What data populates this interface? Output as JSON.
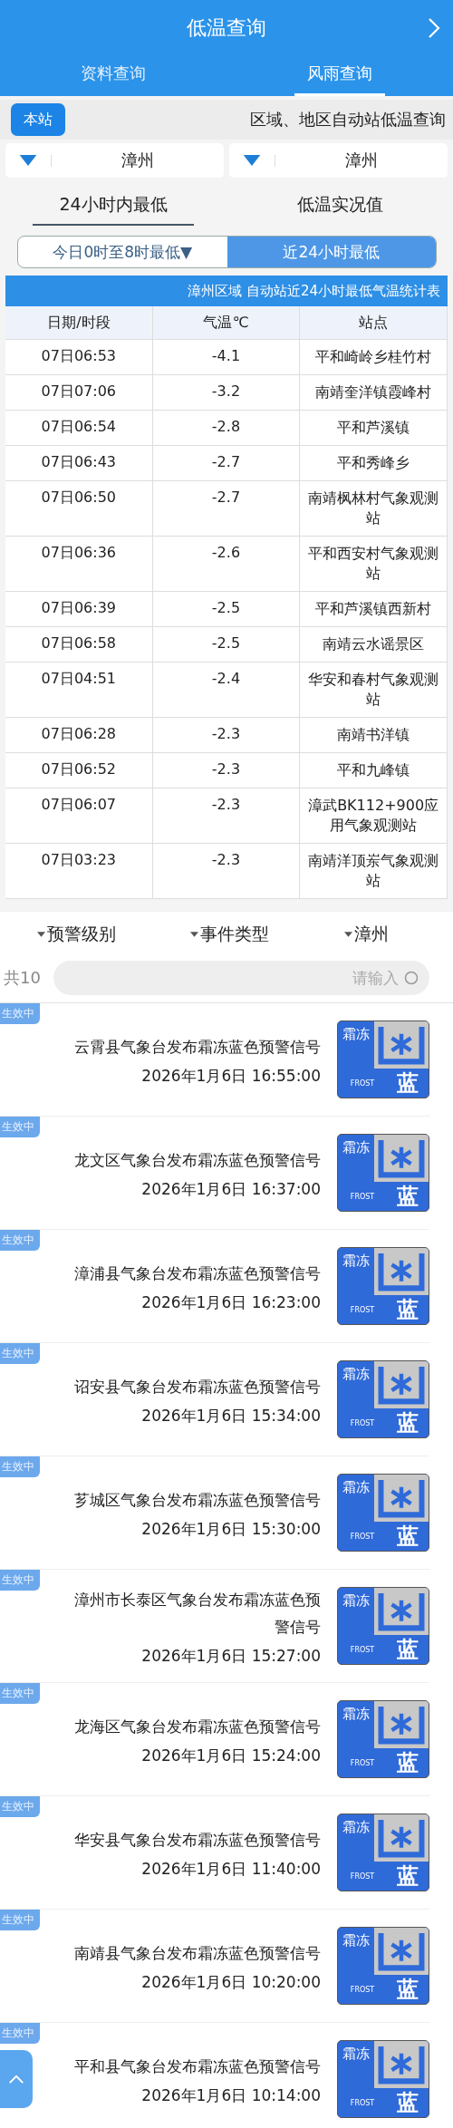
{
  "header": {
    "title": "低温查询"
  },
  "tabs": [
    {
      "label": "资料查询",
      "selected": false
    },
    {
      "label": "风雨查询",
      "selected": true
    }
  ],
  "notice": {
    "button": "本站",
    "text": "区域、地区自动站低温查询"
  },
  "selects": [
    {
      "value": "漳州"
    },
    {
      "value": "漳州"
    }
  ],
  "sub_tabs": [
    {
      "label": "24小时内最低",
      "selected": true
    },
    {
      "label": "低温实况值",
      "selected": false
    }
  ],
  "segments": [
    {
      "label": "今日0时至8时最低▼",
      "selected": false
    },
    {
      "label": "近24小时最低",
      "selected": true
    }
  ],
  "table": {
    "title": "漳州区域 自动站近24小时最低气温统计表",
    "columns": [
      "日期/时段",
      "气温℃",
      "站点"
    ],
    "rows": [
      [
        "07日06:53",
        "-4.1",
        "平和崎岭乡桂竹村"
      ],
      [
        "07日07:06",
        "-3.2",
        "南靖奎洋镇霞峰村"
      ],
      [
        "07日06:54",
        "-2.8",
        "平和芦溪镇"
      ],
      [
        "07日06:43",
        "-2.7",
        "平和秀峰乡"
      ],
      [
        "07日06:50",
        "-2.7",
        "南靖枫林村气象观测站"
      ],
      [
        "07日06:36",
        "-2.6",
        "平和西安村气象观测站"
      ],
      [
        "07日06:39",
        "-2.5",
        "平和芦溪镇西新村"
      ],
      [
        "07日06:58",
        "-2.5",
        "南靖云水谣景区"
      ],
      [
        "07日04:51",
        "-2.4",
        "华安和春村气象观测站"
      ],
      [
        "07日06:28",
        "-2.3",
        "南靖书洋镇"
      ],
      [
        "07日06:52",
        "-2.3",
        "平和九峰镇"
      ],
      [
        "07日06:07",
        "-2.3",
        "漳武BK112+900应用气象观测站"
      ],
      [
        "07日03:23",
        "-2.3",
        "南靖洋顶岽气象观测站"
      ]
    ]
  },
  "filters": [
    {
      "label": "预警级别"
    },
    {
      "label": "事件类型"
    },
    {
      "label": "漳州"
    }
  ],
  "search": {
    "count": "共10",
    "placeholder": "请输入"
  },
  "alerts": [
    {
      "status": "生效中",
      "title": "云霄县气象台发布霜冻蓝色预警信号",
      "time": "2026年1月6日 16:55:00",
      "sign": [
        "霜冻",
        "FROST",
        "蓝"
      ]
    },
    {
      "status": "生效中",
      "title": "龙文区气象台发布霜冻蓝色预警信号",
      "time": "2026年1月6日 16:37:00",
      "sign": [
        "霜冻",
        "FROST",
        "蓝"
      ]
    },
    {
      "status": "生效中",
      "title": "漳浦县气象台发布霜冻蓝色预警信号",
      "time": "2026年1月6日 16:23:00",
      "sign": [
        "霜冻",
        "FROST",
        "蓝"
      ]
    },
    {
      "status": "生效中",
      "title": "诏安县气象台发布霜冻蓝色预警信号",
      "time": "2026年1月6日 15:34:00",
      "sign": [
        "霜冻",
        "FROST",
        "蓝"
      ]
    },
    {
      "status": "生效中",
      "title": "芗城区气象台发布霜冻蓝色预警信号",
      "time": "2026年1月6日 15:30:00",
      "sign": [
        "霜冻",
        "FROST",
        "蓝"
      ]
    },
    {
      "status": "生效中",
      "title": "漳州市长泰区气象台发布霜冻蓝色预警信号",
      "time": "2026年1月6日 15:27:00",
      "sign": [
        "霜冻",
        "FROST",
        "蓝"
      ]
    },
    {
      "status": "生效中",
      "title": "龙海区气象台发布霜冻蓝色预警信号",
      "time": "2026年1月6日 15:24:00",
      "sign": [
        "霜冻",
        "FROST",
        "蓝"
      ]
    },
    {
      "status": "生效中",
      "title": "华安县气象台发布霜冻蓝色预警信号",
      "time": "2026年1月6日 11:40:00",
      "sign": [
        "霜冻",
        "FROST",
        "蓝"
      ]
    },
    {
      "status": "生效中",
      "title": "南靖县气象台发布霜冻蓝色预警信号",
      "time": "2026年1月6日 10:20:00",
      "sign": [
        "霜冻",
        "FROST",
        "蓝"
      ]
    },
    {
      "status": "生效中",
      "title": "平和县气象台发布霜冻蓝色预警信号",
      "time": "2026年1月6日 10:14:00",
      "sign": [
        "霜冻",
        "FROST",
        "蓝"
      ]
    }
  ]
}
